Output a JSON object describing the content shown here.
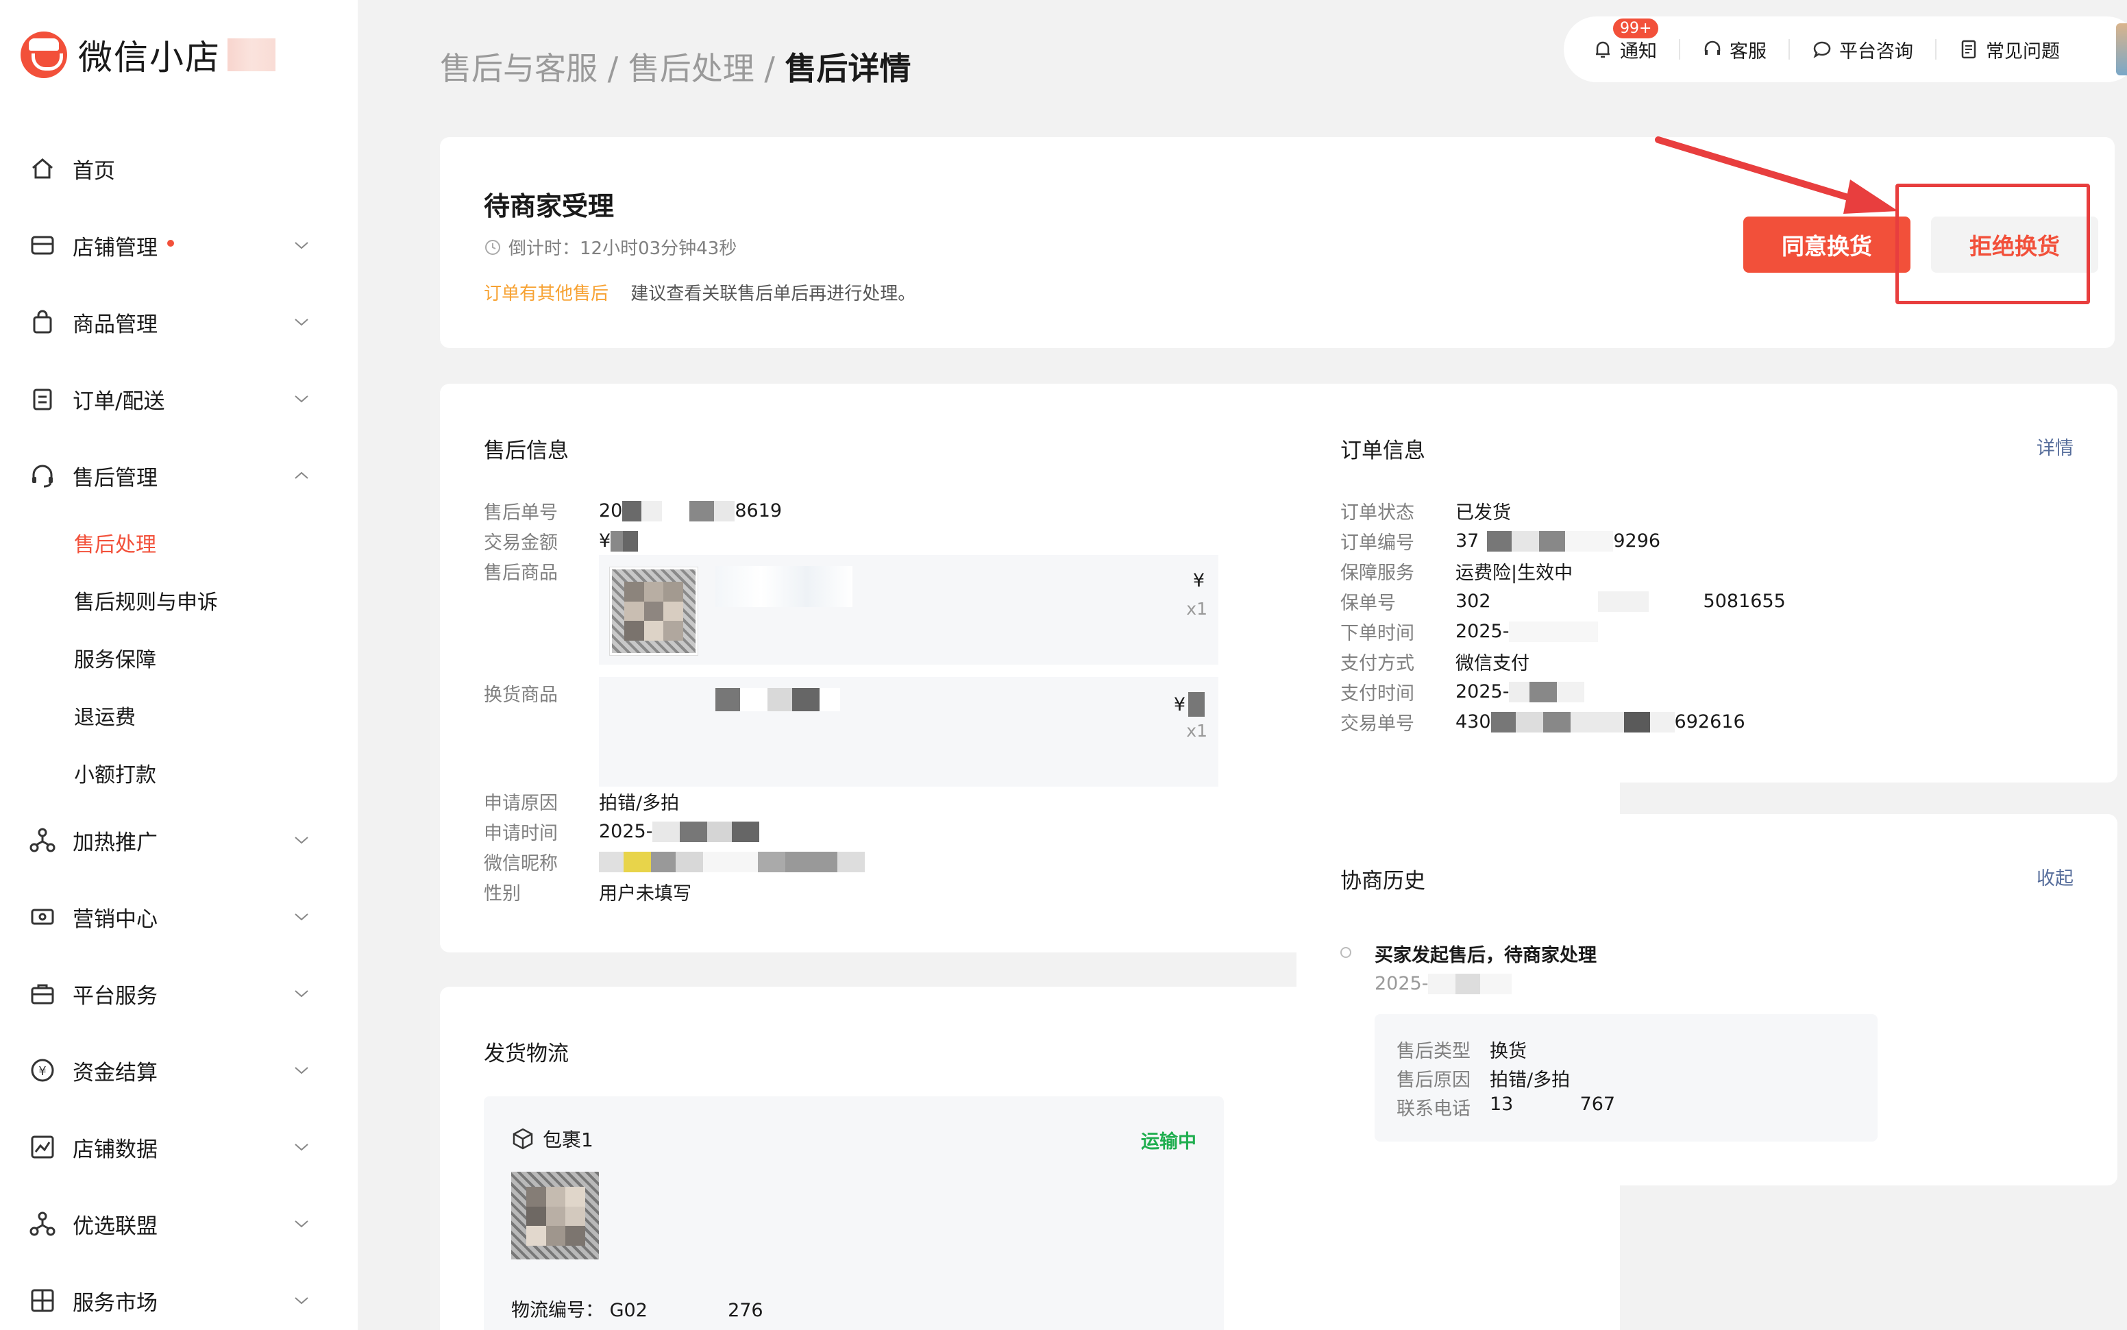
{
  "app": {
    "name": "微信小店"
  },
  "sidebar": {
    "items": [
      {
        "label": "首页",
        "icon": "home-icon"
      },
      {
        "label": "店铺管理",
        "icon": "store-icon",
        "dot": true
      },
      {
        "label": "商品管理",
        "icon": "bag-icon"
      },
      {
        "label": "订单/配送",
        "icon": "clipboard-icon"
      },
      {
        "label": "售后管理",
        "icon": "headset-icon",
        "expanded": true
      },
      {
        "label": "加热推广",
        "icon": "share-icon"
      },
      {
        "label": "营销中心",
        "icon": "ticket-icon"
      },
      {
        "label": "平台服务",
        "icon": "briefcase-icon"
      },
      {
        "label": "资金结算",
        "icon": "yuan-icon"
      },
      {
        "label": "店铺数据",
        "icon": "chart-icon"
      },
      {
        "label": "优选联盟",
        "icon": "share-icon"
      },
      {
        "label": "服务市场",
        "icon": "puzzle-icon"
      }
    ],
    "submenu": [
      "售后处理",
      "售后规则与申诉",
      "服务保障",
      "退运费",
      "小额打款"
    ],
    "active_submenu": "售后处理"
  },
  "breadcrumb": {
    "part1": "售后与客服",
    "sep": "/",
    "part2": "售后处理",
    "current": "售后详情"
  },
  "topbar": {
    "notify_label": "通知",
    "notify_badge": "99+",
    "service_label": "客服",
    "consult_label": "平台咨询",
    "faq_label": "常见问题"
  },
  "status": {
    "title": "待商家受理",
    "countdown_label": "倒计时：",
    "countdown_value": "12小时03分钟43秒",
    "hint_highlight": "订单有其他售后",
    "hint_text": "建议查看关联售后单后再进行处理。",
    "agree_button": "同意换货",
    "reject_button": "拒绝换货"
  },
  "aftersale_info": {
    "title": "售后信息",
    "order_no_label": "售后单号",
    "order_no_prefix": "20",
    "order_no_suffix": "8619",
    "amount_label": "交易金额",
    "amount_prefix": "¥",
    "product_label": "售后商品",
    "product_price": "¥",
    "product_qty": "x1",
    "exchange_label": "换货商品",
    "exchange_price": "¥",
    "exchange_qty": "x1",
    "reason_label": "申请原因",
    "reason_value": "拍错/多拍",
    "time_label": "申请时间",
    "time_prefix": "2025-",
    "nickname_label": "微信昵称",
    "gender_label": "性别",
    "gender_value": "用户未填写"
  },
  "order_info": {
    "title": "订单信息",
    "link": "详情",
    "status_label": "订单状态",
    "status_value": "已发货",
    "order_no_label": "订单编号",
    "order_no_prefix": "37",
    "order_no_suffix": "9296",
    "guarantee_label": "保障服务",
    "guarantee_value": "运费险|生效中",
    "policy_label": "保单号",
    "policy_prefix": "302",
    "policy_suffix": "5081655",
    "order_time_label": "下单时间",
    "order_time_prefix": "2025-",
    "pay_method_label": "支付方式",
    "pay_method_value": "微信支付",
    "pay_time_label": "支付时间",
    "pay_time_prefix": "2025-",
    "txn_label": "交易单号",
    "txn_prefix": "430",
    "txn_suffix": "692616"
  },
  "history": {
    "title": "协商历史",
    "link": "收起",
    "event": "买家发起售后，待商家处理",
    "time_prefix": "2025-",
    "type_label": "售后类型",
    "type_value": "换货",
    "reason_label": "售后原因",
    "reason_value": "拍错/多拍",
    "phone_label": "联系电话",
    "phone_prefix": "13",
    "phone_suffix": "767"
  },
  "shipping": {
    "title": "发货物流",
    "package_label": "包裹1",
    "status": "运输中",
    "tracking_label": "物流编号：",
    "tracking_prefix": "G02",
    "tracking_suffix": "276"
  },
  "colors": {
    "accent": "#f2503a",
    "success": "#1fae4f",
    "warning": "#f7a233",
    "link": "#566d9b",
    "annotation": "#e83e3e"
  }
}
